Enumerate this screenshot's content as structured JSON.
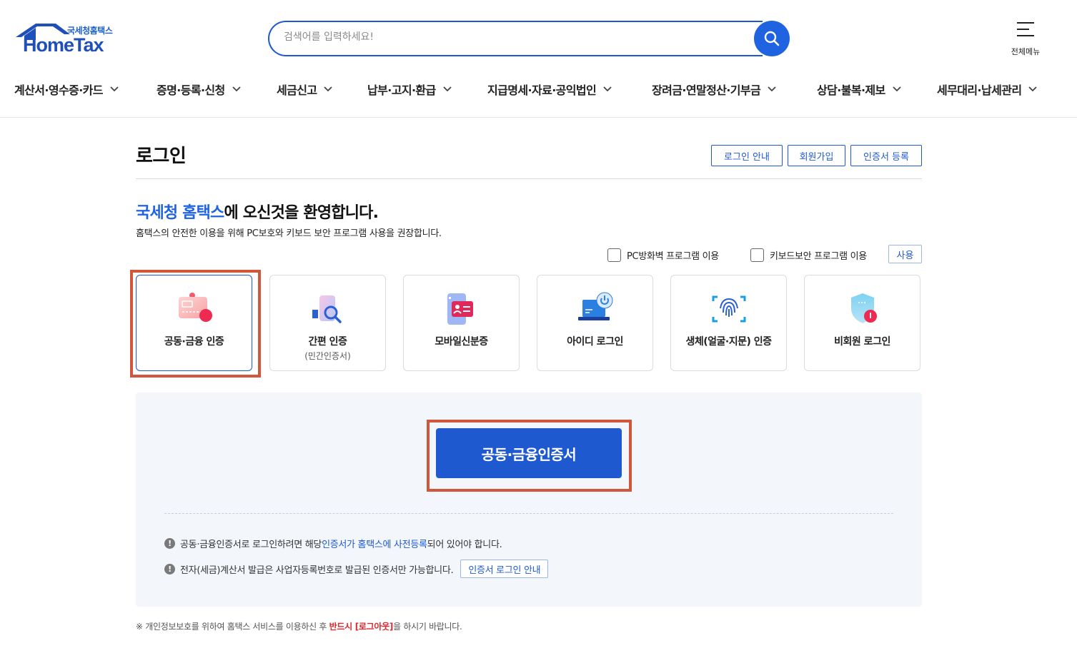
{
  "header": {
    "logo_sub": "국세청홈택스",
    "logo_main": "HomeTax",
    "search_placeholder": "검색어를 입력하세요!",
    "all_menu_label": "전체메뉴",
    "nav": [
      {
        "label": "계산서·영수증·카드"
      },
      {
        "label": "증명·등록·신청"
      },
      {
        "label": "세금신고"
      },
      {
        "label": "납부·고지·환급"
      },
      {
        "label": "지급명세·자료·공익법인"
      },
      {
        "label": "장려금·연말정산·기부금"
      },
      {
        "label": "상담·불복·제보"
      },
      {
        "label": "세무대리·납세관리"
      }
    ]
  },
  "page": {
    "title": "로그인",
    "top_buttons": [
      "로그인 안내",
      "회원가입",
      "인증서 등록"
    ],
    "welcome_highlight": "국세청 홈택스",
    "welcome_rest": "에 오신것을 환영합니다.",
    "welcome_sub": "홈택스의 안전한 이용을 위해 PC보호와 키보드 보안 프로그램 사용을 권장합니다.",
    "checkbox_pc": "PC방화벽 프로그램 이용",
    "checkbox_keyboard": "키보드보안 프로그램 이용",
    "use_button": "사용"
  },
  "login_methods": [
    {
      "label": "공동·금융 인증",
      "sub": "",
      "icon": "certificate-card-icon",
      "selected": true
    },
    {
      "label": "간편 인증",
      "sub": "(민간인증서)",
      "icon": "simple-auth-search-icon",
      "selected": false
    },
    {
      "label": "모바일신분증",
      "sub": "",
      "icon": "mobile-id-icon",
      "selected": false
    },
    {
      "label": "아이디 로그인",
      "sub": "",
      "icon": "laptop-power-icon",
      "selected": false
    },
    {
      "label": "생체(얼굴·지문) 인증",
      "sub": "",
      "icon": "fingerprint-icon",
      "selected": false
    },
    {
      "label": "비회원 로그인",
      "sub": "",
      "icon": "shield-icon",
      "selected": false
    }
  ],
  "panel": {
    "cert_button": "공동·금융인증서",
    "note1_prefix": "공동·금융인증서로 로그인하려면 해당 ",
    "note1_link": "인증서가 홈택스에 사전등록",
    "note1_suffix": "되어 있어야 합니다.",
    "note2_text": "전자(세금)계산서 발급은 사업자등록번호로 발급된 인증서만 가능합니다.",
    "note2_button": "인증서 로그인 안내"
  },
  "footer": {
    "prefix": "※ 개인정보보호를 위하여 홈택스 서비스를 이용하신 후 ",
    "highlight": "반드시 [로그아웃]",
    "suffix": "을 하시기 바랍니다."
  },
  "colors": {
    "brand_blue": "#1f59d0",
    "highlight_box": "#d0573b",
    "warning_red": "#e0262b"
  }
}
